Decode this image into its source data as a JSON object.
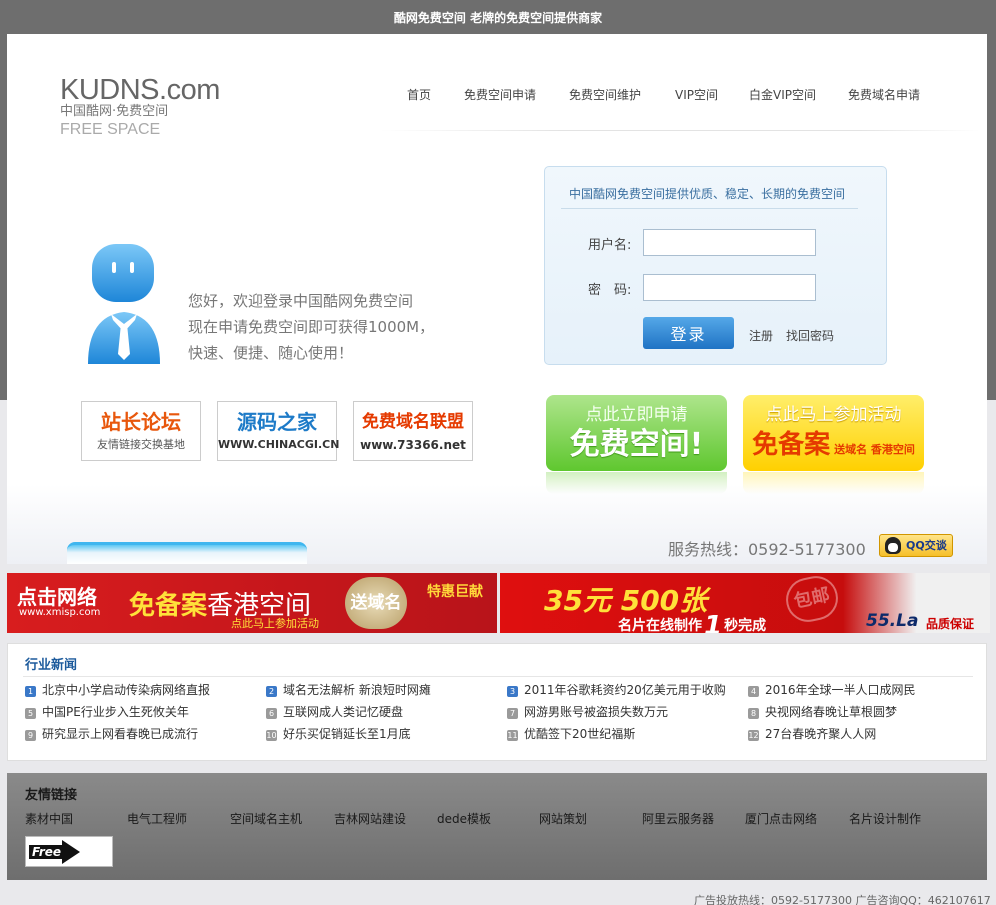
{
  "top_banner": "酷网免费空间 老牌的免费空间提供商家",
  "logo": {
    "line1": "KUDNS.com",
    "line2": "中国酷网·免费空间",
    "line3": "FREE SPACE"
  },
  "nav": [
    "首页",
    "免费空间申请",
    "免费空间维护",
    "VIP空间",
    "白金VIP空间",
    "免费域名申请"
  ],
  "welcome": [
    "您好，欢迎登录中国酷网免费空间",
    "现在申请免费空间即可获得1000M，",
    "快速、便捷、随心使用！"
  ],
  "login": {
    "title": "中国酷网免费空间提供优质、稳定、长期的免费空间",
    "username_label": "用户名:",
    "password_label": "密　码:",
    "username_value": "",
    "password_value": "",
    "submit": "登录",
    "register": "注册",
    "recover": "找回密码"
  },
  "partners": [
    {
      "big": "站长论坛",
      "small": "友情链接交换基地"
    },
    {
      "big": "源码之家",
      "small": "WWW.CHINACGI.CN"
    },
    {
      "big": "免费域名联盟",
      "small": "www.73366.net"
    }
  ],
  "promos": {
    "green": {
      "line1": "点此立即申请",
      "line2": "免费空间!"
    },
    "yellow": {
      "line1": "点此马上参加活动",
      "line2": "免备案",
      "extra": "送域名 香港空间"
    }
  },
  "hotline": "服务热线：0592-5177300",
  "qq_button": "QQ交谈",
  "banner_left": {
    "logo": "点击网络",
    "url": "www.xmisp.com",
    "head_yellow": "免备案",
    "head_white": "香港空间",
    "sub": "点此马上参加活动",
    "seal": "送域名",
    "tag": "特惠巨献"
  },
  "banner_right": {
    "price": "35元 500张",
    "mid_a": "名片在线制作",
    "mid_one": "1",
    "mid_b": "秒完成",
    "stamp": "包邮",
    "brand": "55.La",
    "quality": "品质保证"
  },
  "news": {
    "title": "行业新闻",
    "items": [
      {
        "num": "1",
        "text": "北京中小学启动传染病网络直报"
      },
      {
        "num": "2",
        "text": "域名无法解析 新浪短时网瘫"
      },
      {
        "num": "3",
        "text": "2011年谷歌耗资约20亿美元用于收购"
      },
      {
        "num": "4",
        "text": "2016年全球一半人口成网民"
      },
      {
        "num": "5",
        "text": "中国PE行业步入生死攸关年"
      },
      {
        "num": "6",
        "text": "互联网成人类记忆硬盘"
      },
      {
        "num": "7",
        "text": "网游男账号被盗损失数万元"
      },
      {
        "num": "8",
        "text": "央视网络春晚让草根圆梦"
      },
      {
        "num": "9",
        "text": "研究显示上网看春晚已成流行"
      },
      {
        "num": "10",
        "text": "好乐买促销延长至1月底"
      },
      {
        "num": "11",
        "text": "优酷签下20世纪福斯"
      },
      {
        "num": "12",
        "text": "27台春晚齐聚人人网"
      }
    ]
  },
  "friends": {
    "title": "友情链接",
    "links": [
      "素材中国",
      "电气工程师",
      "空间域名主机",
      "吉林网站建设",
      "dede模板",
      "网站策划",
      "阿里云服务器",
      "厦门点击网络",
      "名片设计制作"
    ],
    "badge": "Free"
  },
  "footer": "广告投放热线：0592-5177300  广告咨询QQ：462107617",
  "colors": {
    "nav_blue": "#1c5a9c",
    "promo_green": "#5fc72f",
    "promo_yellow": "#ffd000",
    "banner_red": "#d81d1e"
  }
}
